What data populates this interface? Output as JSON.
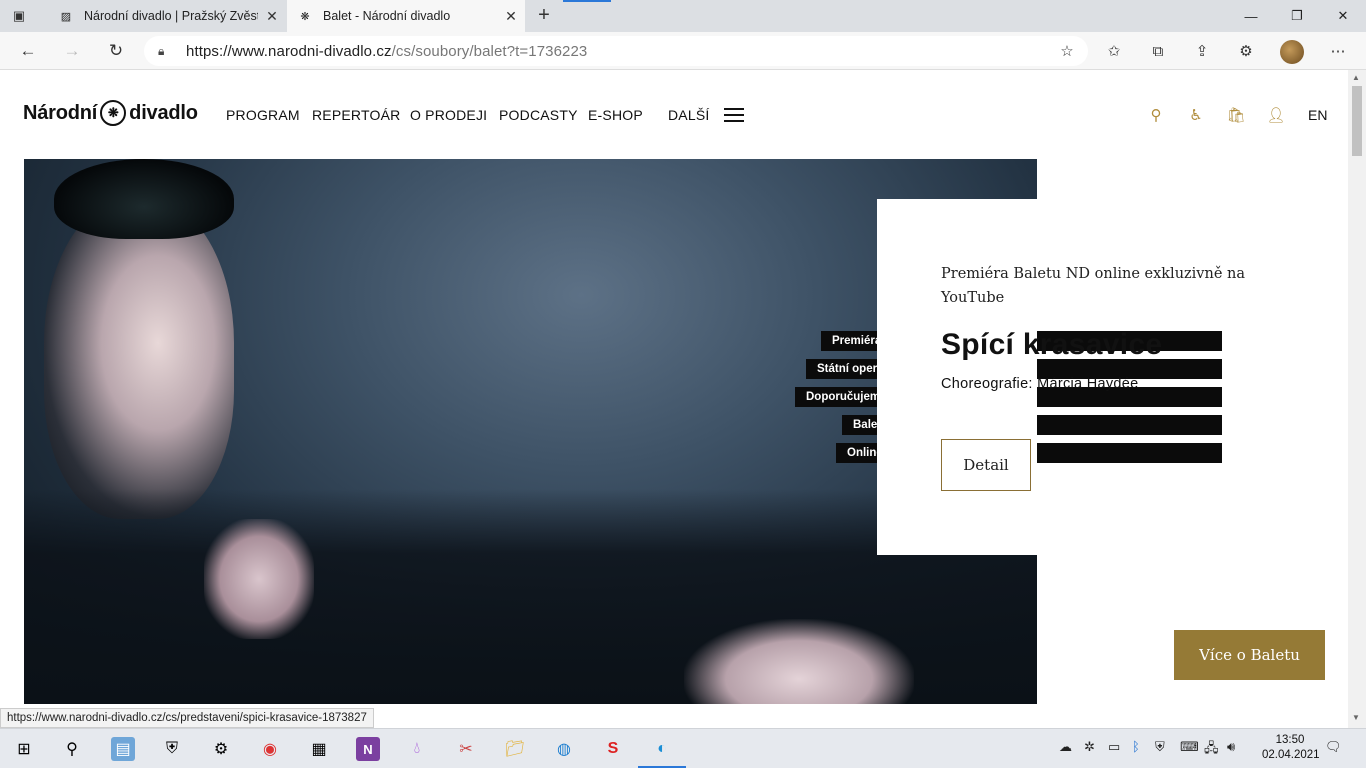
{
  "browser": {
    "tabs": [
      {
        "title": "Národní divadlo | Pražský Zvěstn",
        "active": false
      },
      {
        "title": "Balet - Národní divadlo",
        "active": true
      }
    ],
    "url_domain": "https://www.narodni-divadlo.cz",
    "url_path": "/cs/soubory/balet?t=1736223",
    "icons": [
      "back-icon",
      "forward-icon",
      "refresh-icon",
      "lock-icon",
      "add-favorite-icon",
      "favorites-icon",
      "collections-icon",
      "share-icon",
      "extensions-icon",
      "profile-avatar",
      "more-icon"
    ]
  },
  "site": {
    "logo_left": "Národní",
    "logo_right": "divadlo",
    "menu": [
      "PROGRAM",
      "REPERTOÁR",
      "O PRODEJI",
      "PODCASTY",
      "E-SHOP",
      "DALŠÍ"
    ],
    "lang": "EN",
    "accent": "#957a36"
  },
  "hero": {
    "tags": [
      "Premiéra",
      "Státní opera",
      "Doporučujeme",
      "Balet",
      "Online"
    ],
    "subtitle": "Premiéra Baletu ND online exkluzivně na YouTube",
    "title": "Spící krasavice",
    "choreo": "Choreografie: Márcia Haydée",
    "detail_label": "Detail",
    "more_label": "Více o Baletu"
  },
  "status_url": "https://www.narodni-divadlo.cz/cs/predstaveni/spici-krasavice-1873827",
  "taskbar": {
    "time": "13:50",
    "date": "02.04.2021"
  }
}
